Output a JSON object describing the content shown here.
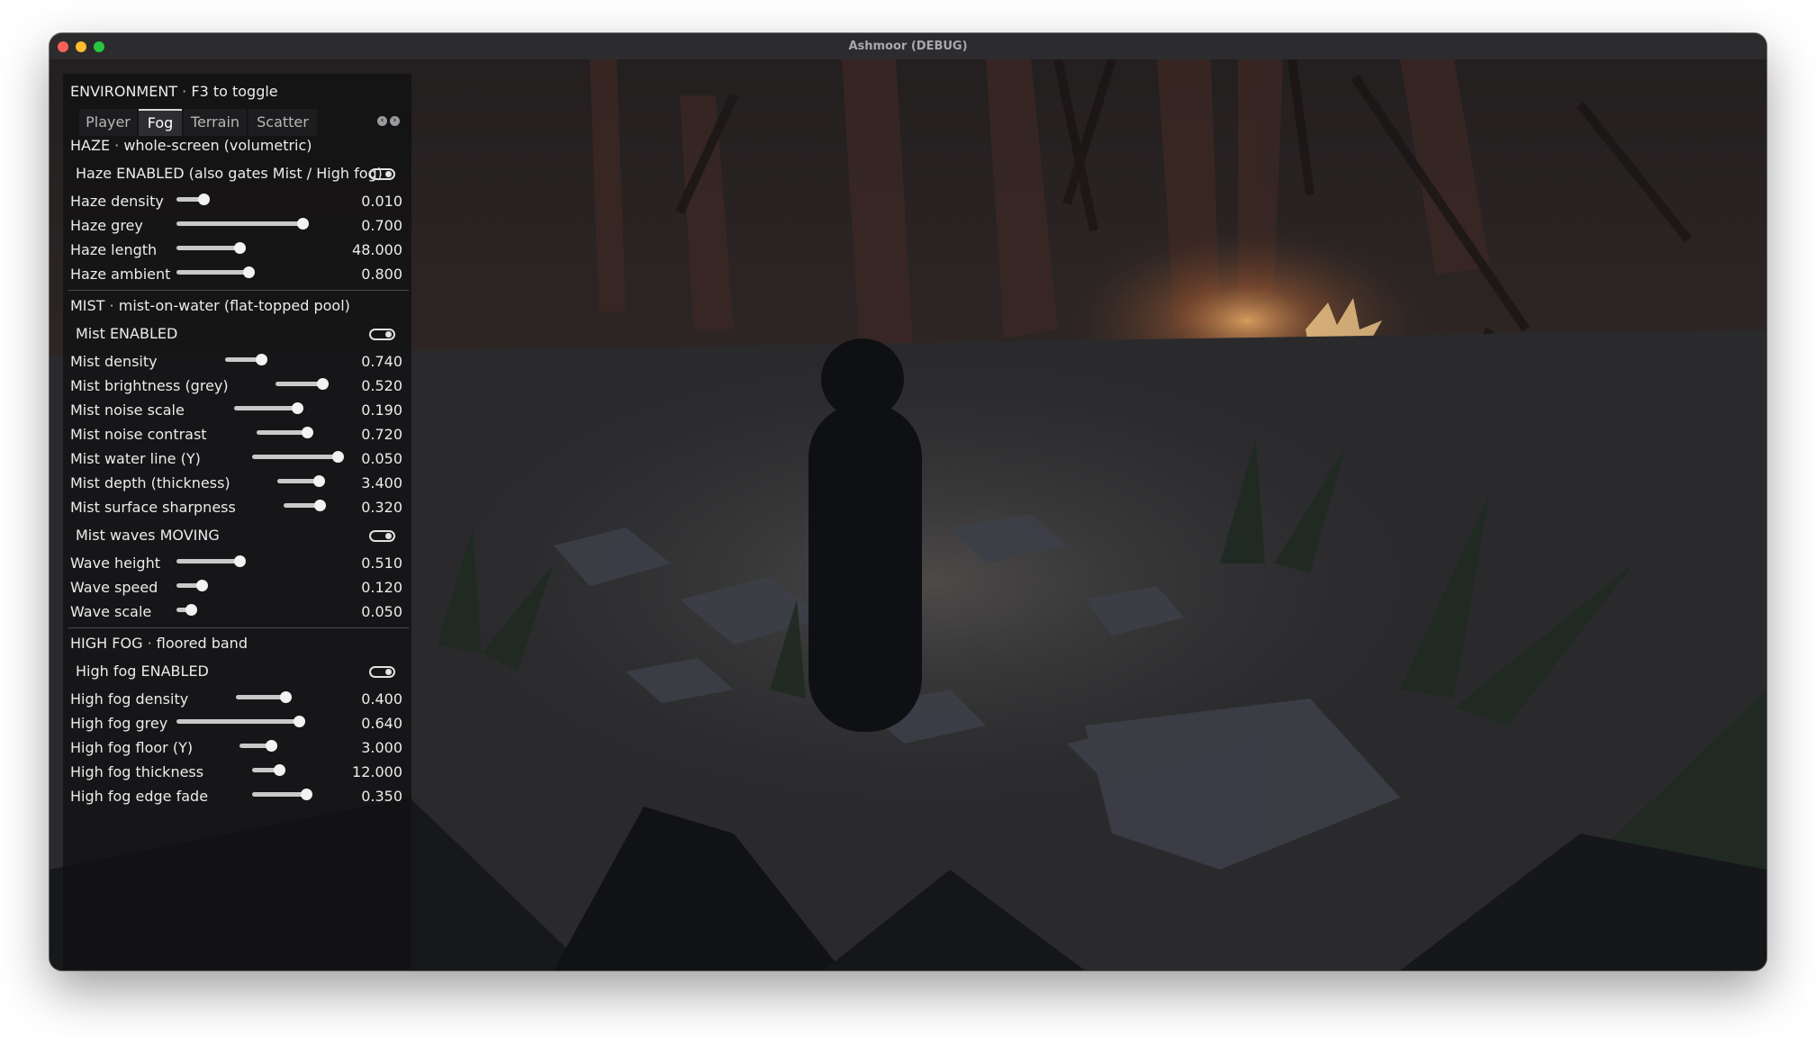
{
  "window": {
    "title": "Ashmoor (DEBUG)"
  },
  "panel": {
    "header_label": "ENVIRONMENT",
    "header_sep": "·",
    "header_hint": "F3 to toggle",
    "tabs": [
      {
        "label": "Player",
        "active": false
      },
      {
        "label": "Fog",
        "active": true
      },
      {
        "label": "Terrain",
        "active": false
      },
      {
        "label": "Scatter",
        "active": false
      }
    ],
    "haze": {
      "title": "HAZE",
      "sep": "·",
      "subtitle": "whole-screen (volumetric)",
      "toggle_label": "Haze ENABLED  (also gates Mist / High fog)",
      "toggle_on": true,
      "sliders": [
        {
          "label": "Haze density",
          "value": "0.010",
          "level": 0.15
        },
        {
          "label": "Haze grey",
          "value": "0.700",
          "level": 0.75
        },
        {
          "label": "Haze length",
          "value": "48.000",
          "level": 0.48
        },
        {
          "label": "Haze ambient",
          "value": "0.800",
          "level": 0.65
        }
      ]
    },
    "mist": {
      "title": "MIST",
      "sep": "·",
      "subtitle": "mist-on-water (flat-topped pool)",
      "toggle_label": "Mist ENABLED",
      "toggle_on": true,
      "sliders": [
        {
          "label": "Mist density",
          "value": "0.740",
          "level": 0.7
        },
        {
          "label": "Mist brightness (grey)",
          "value": "0.520",
          "level": 0.7
        },
        {
          "label": "Mist noise scale",
          "value": "0.190",
          "level": 0.75
        },
        {
          "label": "Mist noise contrast",
          "value": "0.720",
          "level": 0.75
        },
        {
          "label": "Mist water line (Y)",
          "value": "0.050",
          "level": 0.8
        },
        {
          "label": "Mist depth (thickness)",
          "value": "3.400",
          "level": 0.7
        },
        {
          "label": "Mist surface sharpness",
          "value": "0.320",
          "level": 0.7
        }
      ],
      "waves_toggle_label": "Mist waves MOVING",
      "waves_toggle_on": true,
      "wave_sliders": [
        {
          "label": "Wave height",
          "value": "0.510",
          "level": 0.5
        },
        {
          "label": "Wave speed",
          "value": "0.120",
          "level": 0.25
        },
        {
          "label": "Wave scale",
          "value": "0.050",
          "level": 0.1
        }
      ]
    },
    "highfog": {
      "title": "HIGH FOG",
      "sep": "·",
      "subtitle": "floored band",
      "toggle_label": "High fog ENABLED",
      "toggle_on": true,
      "sliders": [
        {
          "label": "High fog density",
          "value": "0.400",
          "level": 0.6
        },
        {
          "label": "High fog grey",
          "value": "0.640",
          "level": 0.85
        },
        {
          "label": "High fog floor (Y)",
          "value": "3.000",
          "level": 0.45
        },
        {
          "label": "High fog thickness",
          "value": "12.000",
          "level": 0.6
        },
        {
          "label": "High fog edge fade",
          "value": "0.350",
          "level": 0.75
        }
      ]
    }
  },
  "colors": {
    "panel_bg": "#111113",
    "text": "#ececec",
    "accent": "#f2f2f2",
    "fire_glow": "#f0a35a"
  },
  "icons": {
    "tab_prev": "chevron-left-icon",
    "tab_next": "chevron-right-icon"
  }
}
